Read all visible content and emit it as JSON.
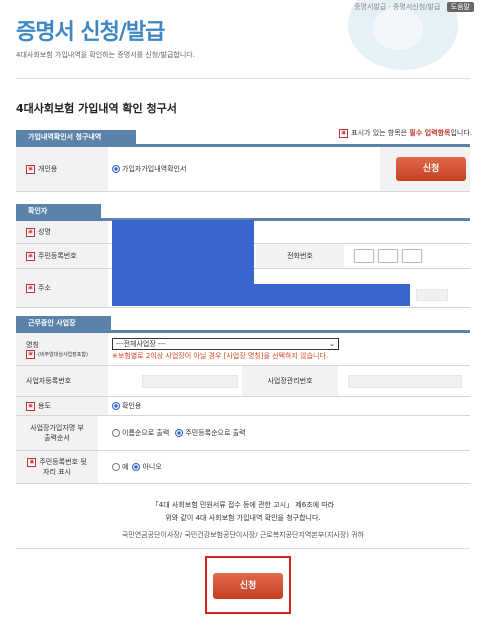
{
  "header": {
    "title": "증명서 신청/발급",
    "subtitle": "4대사회보험 가입내역을 확인하는 증명서를 신청/발급합니다.",
    "topnav_text": "증명서발급 · 증명서신청/발급",
    "topnav_pill": "도움말"
  },
  "doc": {
    "title": "4대사회보험 가입내역 확인 청구서",
    "note_prefix": "표시가 있는 항목은",
    "note_req": "필수 입력항목",
    "note_suffix": "입니다."
  },
  "section_request": {
    "tab_label": "가입내역확인서 청구내역",
    "row_label": "개인용",
    "option_label": "가입자가입내역확인서",
    "button_label": "신청"
  },
  "section_confirmer": {
    "tab_label": "확인자",
    "name_label": "성명",
    "rrn_label": "주민등록번호",
    "phone_label": "전화번호",
    "address_label": "주소"
  },
  "section_workplace": {
    "tab_label": "근무중인 사업장",
    "name_label": "명칭",
    "name_sublabel": "(비주얼대상사업장포함)",
    "select_value": "---전체사업장 ---",
    "warning": "※보험별로 2이상 사업장이 아닐 경우 [사업장 명칭]을 선택하지 않습니다.",
    "bizno_label": "사업자등록번호",
    "mgmtno_label": "사업장관리번호",
    "purpose_label": "용도",
    "purpose_option": "확인용",
    "order_label_1": "사업장가입자명 부",
    "order_label_2": "출력순서",
    "order_opt_name": "이름순으로 출력",
    "order_opt_rrn": "주민등록순으로 출력",
    "rrn_show_label_1": "주민등록번호 뒷",
    "rrn_show_label_2": "자리 표시",
    "yes_label": "예",
    "no_label": "아니오"
  },
  "footer": {
    "line1": "「4대 사회보험 민원서류 접수 등에 관한 고시」 제6조에 따라",
    "line2": "위와 같이 4대 사회보험 가입내역 확인을 청구합니다.",
    "orgs": "국민연금공단이사장/ 국민건강보험공단이사장/ 근로복지공단지역본부(지사장) 귀하",
    "submit_label": "신청"
  },
  "colors": {
    "accent_blue": "#3d87c4",
    "section_blue": "#5b82a8",
    "button_red": "#c2401f",
    "highlight_red": "#d21f1f",
    "redaction_blue": "#3a65cf"
  }
}
